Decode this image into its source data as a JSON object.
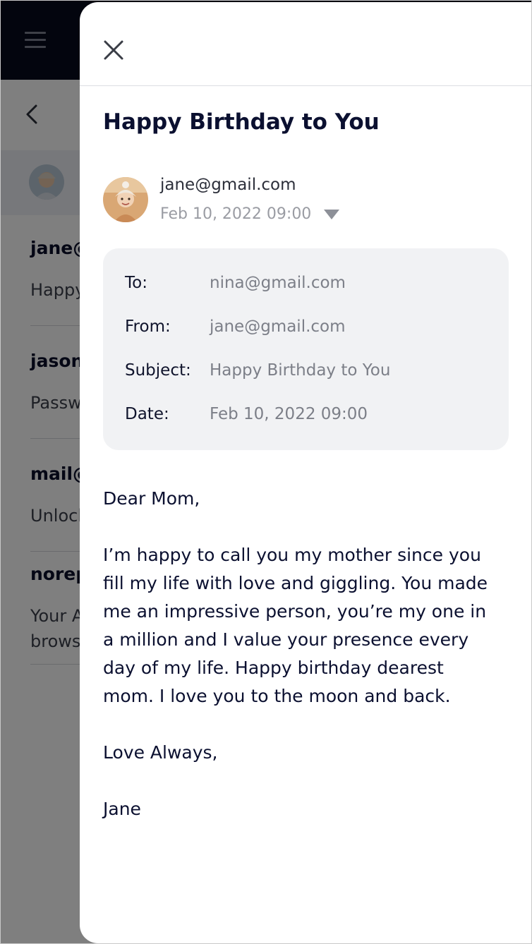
{
  "inbox": {
    "items": [
      {
        "sender": "jane@gmail.com",
        "preview": [
          "Happy Birthday to You"
        ]
      },
      {
        "sender": "jason@gmail.com",
        "preview": [
          "Password"
        ]
      },
      {
        "sender": "mail@",
        "preview": [
          "Unlock"
        ]
      },
      {
        "sender": "noreply",
        "preview": [
          "Your A",
          "brows"
        ]
      }
    ]
  },
  "email": {
    "subject": "Happy Birthday to You",
    "sender_email": "jane@gmail.com",
    "date": "Feb 10, 2022 09:00",
    "details": [
      {
        "label": "To:",
        "value": "nina@gmail.com"
      },
      {
        "label": "From:",
        "value": "jane@gmail.com"
      },
      {
        "label": "Subject:",
        "value": "Happy Birthday to You"
      },
      {
        "label": "Date:",
        "value": "Feb 10, 2022 09:00"
      }
    ],
    "greeting": "Dear Mom,",
    "body_lines": [
      "I’m happy to call you my mother since you",
      "fill my life with love and giggling. You made",
      "me an impressive person, you’re my one in",
      "a million and I value your presence every",
      "day of my life. Happy birthday dearest",
      "mom. I love you to the moon and back."
    ],
    "closing": "Love Always,",
    "signature": "Jane"
  },
  "icons": {
    "menu": "hamburger-menu-icon",
    "back": "chevron-left-icon",
    "close": "close-icon",
    "dropdown": "triangle-down-icon"
  },
  "colors": {
    "topbar": "#060a1c",
    "text_primary": "#0b1030",
    "muted": "#7c7f88",
    "meta_background": "#f1f2f4"
  }
}
